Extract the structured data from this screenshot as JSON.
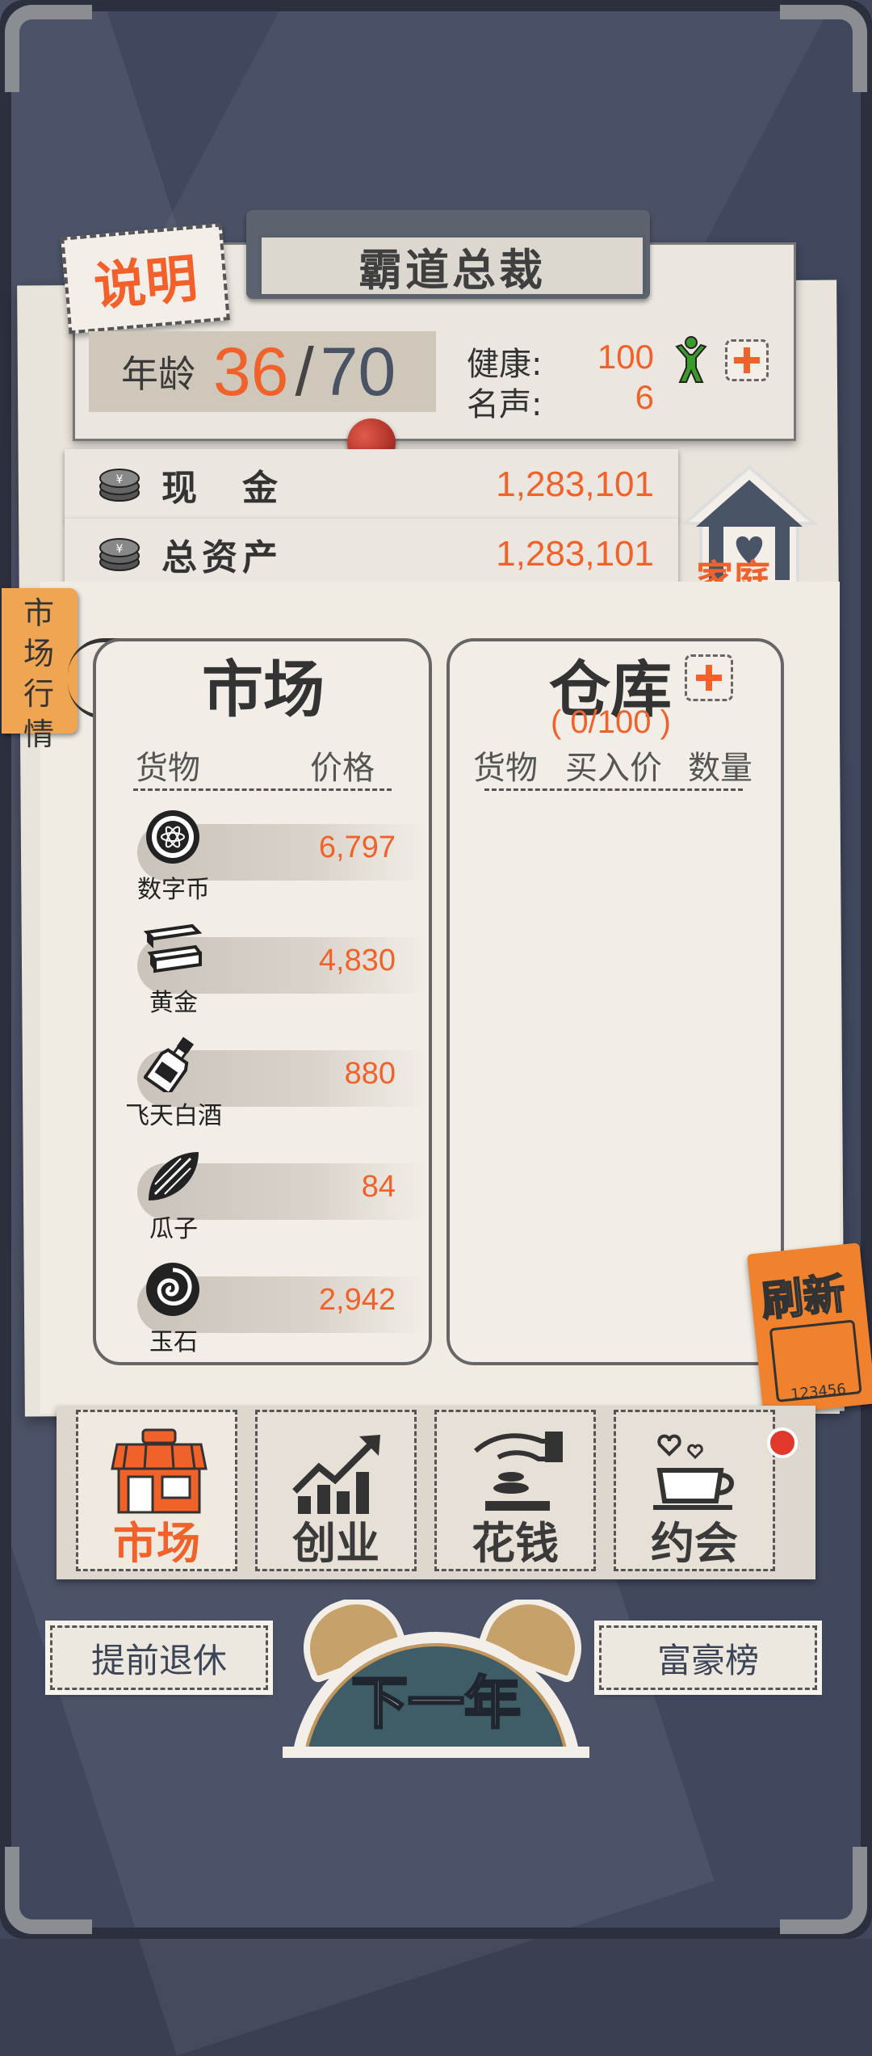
{
  "header": {
    "help_label": "说明",
    "title": "霸道总裁",
    "age_label": "年龄",
    "age_current": "36",
    "age_separator": "/",
    "age_max": "70",
    "health_label": "健康:",
    "health_value": "100",
    "fame_label": "名声:",
    "fame_value": "6"
  },
  "finance": {
    "cash_label": "现　金",
    "cash_value": "1,283,101",
    "assets_label": "总资产",
    "assets_value": "1,283,101"
  },
  "home_label": "家庭",
  "side_tag": [
    "市",
    "场",
    "行",
    "情"
  ],
  "market": {
    "title": "市场",
    "col_goods": "货物",
    "col_price": "价格",
    "items": [
      {
        "name": "数字币",
        "price": "6,797",
        "icon": "crypto-coin-icon"
      },
      {
        "name": "黄金",
        "price": "4,830",
        "icon": "gold-bars-icon"
      },
      {
        "name": "飞天白酒",
        "price": "880",
        "icon": "liquor-bottle-icon"
      },
      {
        "name": "瓜子",
        "price": "84",
        "icon": "sunflower-seed-icon"
      },
      {
        "name": "玉石",
        "price": "2,942",
        "icon": "jade-stone-icon"
      }
    ]
  },
  "storage": {
    "title": "仓库",
    "capacity": "( 0/100 )",
    "col_goods": "货物",
    "col_buy_price": "买入价",
    "col_qty": "数量"
  },
  "refresh": {
    "label": "刷新",
    "ticket_number": "123456"
  },
  "tabs": [
    {
      "label": "市场",
      "icon": "shop-icon",
      "active": true
    },
    {
      "label": "创业",
      "icon": "growth-chart-icon",
      "active": false
    },
    {
      "label": "花钱",
      "icon": "spend-money-icon",
      "active": false
    },
    {
      "label": "约会",
      "icon": "coffee-date-icon",
      "active": false
    }
  ],
  "bottom": {
    "retire_label": "提前退休",
    "next_year_label": "下一年",
    "leaderboard_label": "富豪榜"
  },
  "colors": {
    "accent": "#f0622a",
    "panel_bg": "#f2eee7",
    "background": "#41485e"
  }
}
